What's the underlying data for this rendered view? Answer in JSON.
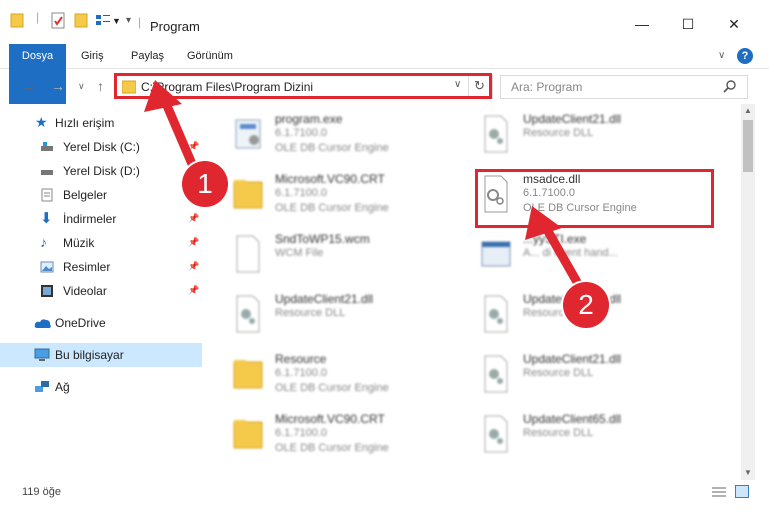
{
  "window": {
    "title": "Program",
    "minimize": "—",
    "maximize": "☐",
    "close": "✕"
  },
  "ribbon": {
    "tabs": [
      "Dosya",
      "Giriş",
      "Paylaş",
      "Görünüm"
    ],
    "help_icon": "?"
  },
  "nav": {
    "address": "C:\\Program Files\\Program Dizini",
    "search_placeholder": "Ara: Program"
  },
  "sidebar": {
    "items": [
      {
        "label": "Hızlı erişim",
        "icon": "star-icon"
      },
      {
        "label": "Yerel Disk (C:)",
        "icon": "drive-icon"
      },
      {
        "label": "Yerel Disk (D:)",
        "icon": "drive-icon"
      },
      {
        "label": "Belgeler",
        "icon": "document-icon"
      },
      {
        "label": "İndirmeler",
        "icon": "download-icon"
      },
      {
        "label": "Müzik",
        "icon": "music-icon"
      },
      {
        "label": "Resimler",
        "icon": "pictures-icon"
      },
      {
        "label": "Videolar",
        "icon": "video-icon"
      },
      {
        "label": "OneDrive",
        "icon": "cloud-icon"
      },
      {
        "label": "Bu bilgisayar",
        "icon": "computer-icon"
      },
      {
        "label": "Ağ",
        "icon": "network-icon"
      }
    ]
  },
  "files": {
    "left": [
      {
        "name": "program.exe",
        "line1": "6.1.7100.0",
        "line2": "OLE DB Cursor Engine"
      },
      {
        "name": "Microsoft.VC90.CRT",
        "line1": "6.1.7100.0",
        "line2": "OLE DB Cursor Engine"
      },
      {
        "name": "SndToWP15.wcm",
        "line1": "WCM File",
        "line2": ""
      },
      {
        "name": "UpdateClient21.dll",
        "line1": "Resource DLL",
        "line2": ""
      },
      {
        "name": "Resource",
        "line1": "6.1.7100.0",
        "line2": "OLE DB Cursor Engine"
      },
      {
        "name": "Microsoft.VC90.CRT",
        "line1": "6.1.7100.0",
        "line2": "OLE DB Cursor Engine"
      }
    ],
    "right": [
      {
        "name": "UpdateClient21.dll",
        "line1": "Resource DLL",
        "line2": ""
      },
      {
        "name": "msadce.dll",
        "line1": "6.1.7100.0",
        "line2": "OLE DB Cursor Engine"
      },
      {
        "name": "...yySTI.exe",
        "line1": "A... di event hand...",
        "line2": ""
      },
      {
        "name": "UpdateClient65.dll",
        "line1": "Resource DLL",
        "line2": ""
      },
      {
        "name": "UpdateClient21.dll",
        "line1": "Resource DLL",
        "line2": ""
      },
      {
        "name": "UpdateClient65.dll",
        "line1": "Resource DLL",
        "line2": ""
      }
    ]
  },
  "status": {
    "count": "119 öğe"
  },
  "annotations": {
    "badge1": "1",
    "badge2": "2",
    "accent": "#e0262f"
  }
}
